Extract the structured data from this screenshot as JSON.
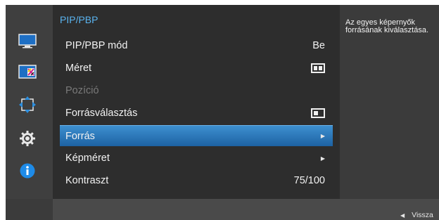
{
  "menu": {
    "title": "PIP/PBP",
    "items": [
      {
        "label": "PIP/PBP mód",
        "value": "Be"
      },
      {
        "label": "Méret",
        "icon": "pbp-size-icon"
      },
      {
        "label": "Pozíció"
      },
      {
        "label": "Forrásválasztás",
        "icon": "source-select-icon"
      },
      {
        "label": "Forrás",
        "icon": "chevron-right-icon"
      },
      {
        "label": "Képméret",
        "icon": "chevron-right-icon"
      },
      {
        "label": "Kontraszt",
        "value": "75/100"
      }
    ]
  },
  "help": {
    "text": "Az egyes képernyők forrásának kiválasztása."
  },
  "footer": {
    "back_label": "Vissza",
    "back_icon": "triangle-left-icon"
  },
  "sidebar": {
    "icons": [
      "monitor-icon",
      "color-icon",
      "move-icon",
      "gear-icon",
      "info-icon"
    ]
  },
  "colors": {
    "title": "#5ab4f0",
    "selected": "#2a78bd",
    "disabled": "#7a7a7a"
  }
}
